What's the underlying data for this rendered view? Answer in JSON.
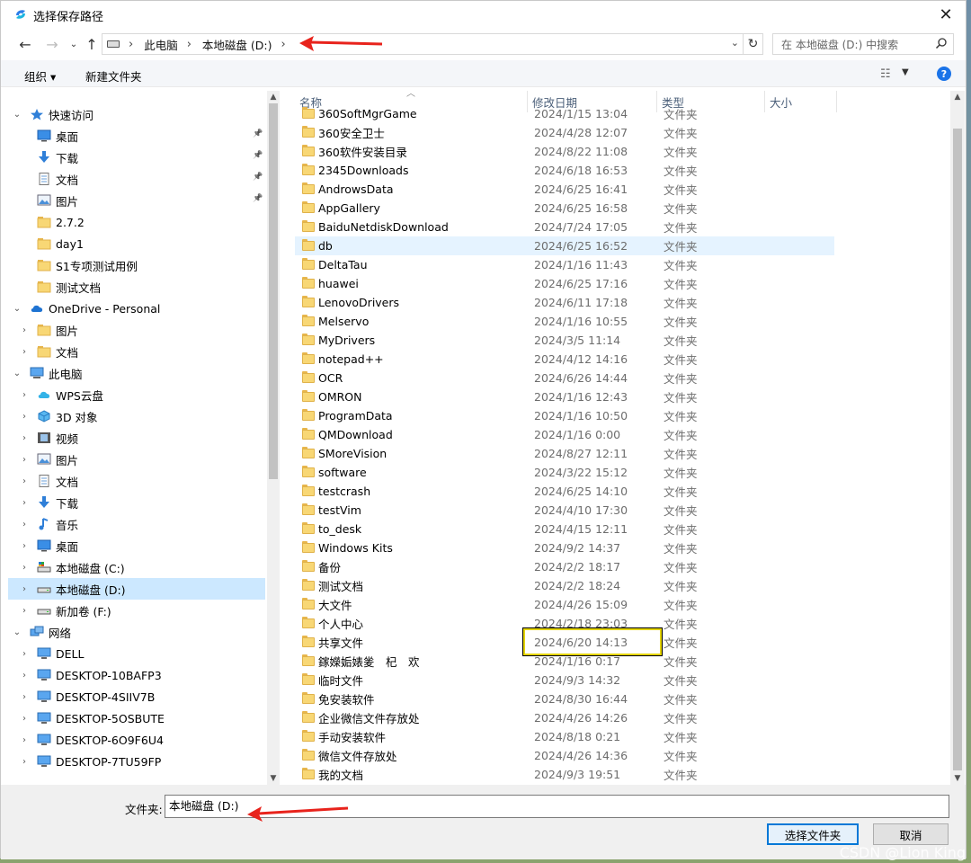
{
  "window": {
    "title": "选择保存路径"
  },
  "address": {
    "crumbs": [
      "此电脑",
      "本地磁盘 (D:)"
    ]
  },
  "search": {
    "placeholder": "在 本地磁盘 (D:) 中搜索"
  },
  "toolbar": {
    "organize": "组织 ▾",
    "new_folder": "新建文件夹"
  },
  "nav": [
    {
      "label": "快速访问",
      "icon": "star-icon",
      "level": 0,
      "chevron": "down",
      "pinned": false
    },
    {
      "label": "桌面",
      "icon": "desktop-icon",
      "level": 1,
      "chevron": "",
      "pinned": true
    },
    {
      "label": "下载",
      "icon": "download-icon",
      "level": 1,
      "chevron": "",
      "pinned": true
    },
    {
      "label": "文档",
      "icon": "document-icon",
      "level": 1,
      "chevron": "",
      "pinned": true
    },
    {
      "label": "图片",
      "icon": "picture-icon",
      "level": 1,
      "chevron": "",
      "pinned": true
    },
    {
      "label": "2.7.2",
      "icon": "folder-icon",
      "level": 1,
      "chevron": "",
      "pinned": false
    },
    {
      "label": "day1",
      "icon": "folder-icon",
      "level": 1,
      "chevron": "",
      "pinned": false
    },
    {
      "label": "S1专项测试用例",
      "icon": "folder-icon",
      "level": 1,
      "chevron": "",
      "pinned": false
    },
    {
      "label": "测试文档",
      "icon": "folder-icon",
      "level": 1,
      "chevron": "",
      "pinned": false
    },
    {
      "label": "OneDrive - Personal",
      "icon": "cloud-icon",
      "level": 0,
      "chevron": "down",
      "pinned": false
    },
    {
      "label": "图片",
      "icon": "folder-icon",
      "level": 1,
      "chevron": "right",
      "pinned": false
    },
    {
      "label": "文档",
      "icon": "folder-icon",
      "level": 1,
      "chevron": "right",
      "pinned": false
    },
    {
      "label": "此电脑",
      "icon": "computer-icon",
      "level": 0,
      "chevron": "down",
      "pinned": false
    },
    {
      "label": "WPS云盘",
      "icon": "wps-cloud-icon",
      "level": 1,
      "chevron": "right",
      "pinned": false
    },
    {
      "label": "3D 对象",
      "icon": "cube-3d-icon",
      "level": 1,
      "chevron": "right",
      "pinned": false
    },
    {
      "label": "视频",
      "icon": "video-icon",
      "level": 1,
      "chevron": "right",
      "pinned": false
    },
    {
      "label": "图片",
      "icon": "picture-icon",
      "level": 1,
      "chevron": "right",
      "pinned": false
    },
    {
      "label": "文档",
      "icon": "document-icon",
      "level": 1,
      "chevron": "right",
      "pinned": false
    },
    {
      "label": "下载",
      "icon": "download-icon",
      "level": 1,
      "chevron": "right",
      "pinned": false
    },
    {
      "label": "音乐",
      "icon": "music-icon",
      "level": 1,
      "chevron": "right",
      "pinned": false
    },
    {
      "label": "桌面",
      "icon": "desktop-icon",
      "level": 1,
      "chevron": "right",
      "pinned": false
    },
    {
      "label": "本地磁盘 (C:)",
      "icon": "drive-c-icon",
      "level": 1,
      "chevron": "right",
      "pinned": false
    },
    {
      "label": "本地磁盘 (D:)",
      "icon": "drive-icon",
      "level": 1,
      "chevron": "right",
      "pinned": false,
      "selected": true
    },
    {
      "label": "新加卷 (F:)",
      "icon": "drive-icon",
      "level": 1,
      "chevron": "right",
      "pinned": false
    },
    {
      "label": "网络",
      "icon": "network-icon",
      "level": 0,
      "chevron": "down",
      "pinned": false
    },
    {
      "label": "DELL",
      "icon": "monitor-icon",
      "level": 1,
      "chevron": "right",
      "pinned": false
    },
    {
      "label": "DESKTOP-10BAFP3",
      "icon": "monitor-icon",
      "level": 1,
      "chevron": "right",
      "pinned": false
    },
    {
      "label": "DESKTOP-4SIIV7B",
      "icon": "monitor-icon",
      "level": 1,
      "chevron": "right",
      "pinned": false
    },
    {
      "label": "DESKTOP-5OSBUTE",
      "icon": "monitor-icon",
      "level": 1,
      "chevron": "right",
      "pinned": false
    },
    {
      "label": "DESKTOP-6O9F6U4",
      "icon": "monitor-icon",
      "level": 1,
      "chevron": "right",
      "pinned": false
    },
    {
      "label": "DESKTOP-7TU59FP",
      "icon": "monitor-icon",
      "level": 1,
      "chevron": "right",
      "pinned": false
    }
  ],
  "columns": {
    "name": "名称",
    "date": "修改日期",
    "type": "类型",
    "size": "大小"
  },
  "files": [
    {
      "name": "360SoftMgrGame",
      "date": "2024/1/15 13:04",
      "type": "文件夹"
    },
    {
      "name": "360安全卫士",
      "date": "2024/4/28 12:07",
      "type": "文件夹"
    },
    {
      "name": "360软件安装目录",
      "date": "2024/8/22 11:08",
      "type": "文件夹"
    },
    {
      "name": "2345Downloads",
      "date": "2024/6/18 16:53",
      "type": "文件夹"
    },
    {
      "name": "AndrowsData",
      "date": "2024/6/25 16:41",
      "type": "文件夹"
    },
    {
      "name": "AppGallery",
      "date": "2024/6/25 16:58",
      "type": "文件夹"
    },
    {
      "name": "BaiduNetdiskDownload",
      "date": "2024/7/24 17:05",
      "type": "文件夹"
    },
    {
      "name": "db",
      "date": "2024/6/25 16:52",
      "type": "文件夹",
      "selected": true
    },
    {
      "name": "DeltaTau",
      "date": "2024/1/16 11:43",
      "type": "文件夹"
    },
    {
      "name": "huawei",
      "date": "2024/6/25 17:16",
      "type": "文件夹"
    },
    {
      "name": "LenovoDrivers",
      "date": "2024/6/11 17:18",
      "type": "文件夹"
    },
    {
      "name": "Melservo",
      "date": "2024/1/16 10:55",
      "type": "文件夹"
    },
    {
      "name": "MyDrivers",
      "date": "2024/3/5 11:14",
      "type": "文件夹"
    },
    {
      "name": "notepad++",
      "date": "2024/4/12 14:16",
      "type": "文件夹"
    },
    {
      "name": "OCR",
      "date": "2024/6/26 14:44",
      "type": "文件夹"
    },
    {
      "name": "OMRON",
      "date": "2024/1/16 12:43",
      "type": "文件夹"
    },
    {
      "name": "ProgramData",
      "date": "2024/1/16 10:50",
      "type": "文件夹"
    },
    {
      "name": "QMDownload",
      "date": "2024/1/16 0:00",
      "type": "文件夹"
    },
    {
      "name": "SMoreVision",
      "date": "2024/8/27 12:11",
      "type": "文件夹"
    },
    {
      "name": "software",
      "date": "2024/3/22 15:12",
      "type": "文件夹"
    },
    {
      "name": "testcrash",
      "date": "2024/6/25 14:10",
      "type": "文件夹"
    },
    {
      "name": "testVim",
      "date": "2024/4/10 17:30",
      "type": "文件夹"
    },
    {
      "name": "to_desk",
      "date": "2024/4/15 12:11",
      "type": "文件夹"
    },
    {
      "name": "Windows Kits",
      "date": "2024/9/2 14:37",
      "type": "文件夹"
    },
    {
      "name": "备份",
      "date": "2024/2/2 18:17",
      "type": "文件夹"
    },
    {
      "name": "测试文档",
      "date": "2024/2/2 18:24",
      "type": "文件夹"
    },
    {
      "name": "大文件",
      "date": "2024/4/26 15:09",
      "type": "文件夹"
    },
    {
      "name": "个人中心",
      "date": "2024/2/18 23:03",
      "type": "文件夹"
    },
    {
      "name": "共享文件",
      "date": "2024/6/20 14:13",
      "type": "文件夹",
      "highlighted": true
    },
    {
      "name": "鎵嬫姤婊夎　杞　欢",
      "date": "2024/1/16 0:17",
      "type": "文件夹"
    },
    {
      "name": "临时文件",
      "date": "2024/9/3 14:32",
      "type": "文件夹"
    },
    {
      "name": "免安装软件",
      "date": "2024/8/30 16:44",
      "type": "文件夹"
    },
    {
      "name": "企业微信文件存放处",
      "date": "2024/4/26 14:26",
      "type": "文件夹"
    },
    {
      "name": "手动安装软件",
      "date": "2024/8/18 0:21",
      "type": "文件夹"
    },
    {
      "name": "微信文件存放处",
      "date": "2024/4/26 14:36",
      "type": "文件夹"
    },
    {
      "name": "我的文档",
      "date": "2024/9/3 19:51",
      "type": "文件夹"
    }
  ],
  "bottom": {
    "folder_label": "文件夹:",
    "folder_value": "本地磁盘 (D:)",
    "select_button": "选择文件夹",
    "cancel_button": "取消"
  },
  "watermark": "CSDN @Lion King",
  "colors": {
    "accent": "#0078d7",
    "selection": "#cce8ff",
    "annotation_arrow": "#e8231c",
    "highlight_box": "#e4d400"
  }
}
